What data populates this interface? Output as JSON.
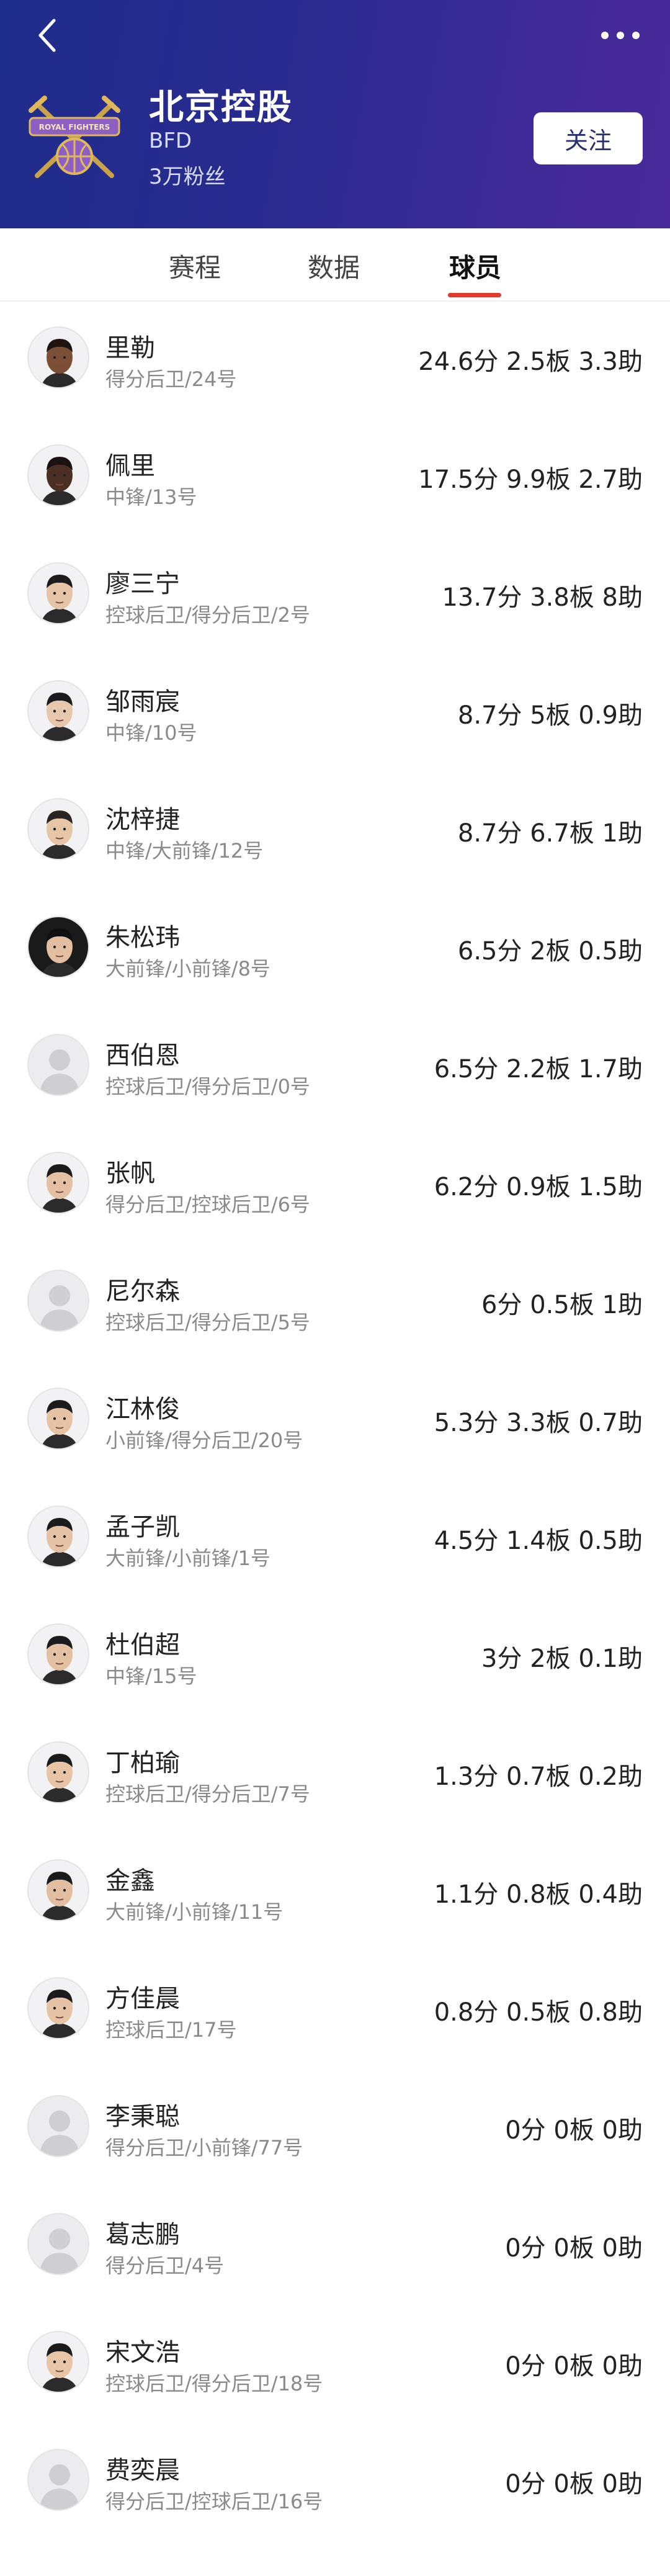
{
  "header": {
    "team_name": "北京控股",
    "team_abbr": "BFD",
    "fans": "3万粉丝",
    "follow_label": "关注",
    "logo_text": "ROYAL FIGHTERS",
    "bg_color": "#2a2a8f"
  },
  "tabs": [
    {
      "label": "赛程"
    },
    {
      "label": "数据"
    },
    {
      "label": "球员",
      "active": true
    }
  ],
  "accent_color": "#e03a2f",
  "players": [
    {
      "name": "里勒",
      "position": "得分后卫/24号",
      "stats": "24.6分 2.5板 3.3助",
      "photo": "photo",
      "skin": "#7a4f36",
      "hair": "#1d1410"
    },
    {
      "name": "佩里",
      "position": "中锋/13号",
      "stats": "17.5分 9.9板 2.7助",
      "photo": "photo",
      "skin": "#4a3022",
      "hair": "#1a1210"
    },
    {
      "name": "廖三宁",
      "position": "控球后卫/得分后卫/2号",
      "stats": "13.7分 3.8板 8助",
      "photo": "photo",
      "skin": "#e6c4a6",
      "hair": "#1b1b1b"
    },
    {
      "name": "邹雨宸",
      "position": "中锋/10号",
      "stats": "8.7分 5板 0.9助",
      "photo": "photo",
      "skin": "#e8c8ad",
      "hair": "#1b1b1b"
    },
    {
      "name": "沈梓捷",
      "position": "中锋/大前锋/12号",
      "stats": "8.7分 6.7板 1助",
      "photo": "photo",
      "skin": "#e7c6a8",
      "hair": "#2a2320"
    },
    {
      "name": "朱松玮",
      "position": "大前锋/小前锋/8号",
      "stats": "6.5分 2板 0.5助",
      "photo": "photo-dark",
      "skin": "#e2bfa0",
      "hair": "#101010"
    },
    {
      "name": "西伯恩",
      "position": "控球后卫/得分后卫/0号",
      "stats": "6.5分 2.2板 1.7助",
      "photo": "placeholder",
      "skin": "",
      "hair": ""
    },
    {
      "name": "张帆",
      "position": "得分后卫/控球后卫/6号",
      "stats": "6.2分 0.9板 1.5助",
      "photo": "photo",
      "skin": "#e4c1a2",
      "hair": "#1b1b1b"
    },
    {
      "name": "尼尔森",
      "position": "控球后卫/得分后卫/5号",
      "stats": "6分 0.5板 1助",
      "photo": "placeholder",
      "skin": "",
      "hair": ""
    },
    {
      "name": "江林俊",
      "position": "小前锋/得分后卫/20号",
      "stats": "5.3分 3.3板 0.7助",
      "photo": "photo",
      "skin": "#e6c3a4",
      "hair": "#1b1b1b"
    },
    {
      "name": "孟子凯",
      "position": "大前锋/小前锋/1号",
      "stats": "4.5分 1.4板 0.5助",
      "photo": "photo",
      "skin": "#e5c2a3",
      "hair": "#1b1b1b"
    },
    {
      "name": "杜伯超",
      "position": "中锋/15号",
      "stats": "3分 2板 0.1助",
      "photo": "photo",
      "skin": "#e3c0a0",
      "hair": "#1b1b1b"
    },
    {
      "name": "丁柏瑜",
      "position": "控球后卫/得分后卫/7号",
      "stats": "1.3分 0.7板 0.2助",
      "photo": "photo",
      "skin": "#e6c4a5",
      "hair": "#1b1b1b"
    },
    {
      "name": "金鑫",
      "position": "大前锋/小前锋/11号",
      "stats": "1.1分 0.8板 0.4助",
      "photo": "photo",
      "skin": "#e2bea0",
      "hair": "#1b1b1b"
    },
    {
      "name": "方佳晨",
      "position": "控球后卫/17号",
      "stats": "0.8分 0.5板 0.8助",
      "photo": "photo",
      "skin": "#e6c3a4",
      "hair": "#1b1b1b"
    },
    {
      "name": "李秉聪",
      "position": "得分后卫/小前锋/77号",
      "stats": "0分 0板 0助",
      "photo": "placeholder",
      "skin": "",
      "hair": ""
    },
    {
      "name": "葛志鹏",
      "position": "得分后卫/4号",
      "stats": "0分 0板 0助",
      "photo": "placeholder",
      "skin": "",
      "hair": ""
    },
    {
      "name": "宋文浩",
      "position": "控球后卫/得分后卫/18号",
      "stats": "0分 0板 0助",
      "photo": "photo",
      "skin": "#e7c5a6",
      "hair": "#1b1b1b"
    },
    {
      "name": "费奕晨",
      "position": "得分后卫/控球后卫/16号",
      "stats": "0分 0板 0助",
      "photo": "placeholder",
      "skin": "",
      "hair": ""
    }
  ]
}
